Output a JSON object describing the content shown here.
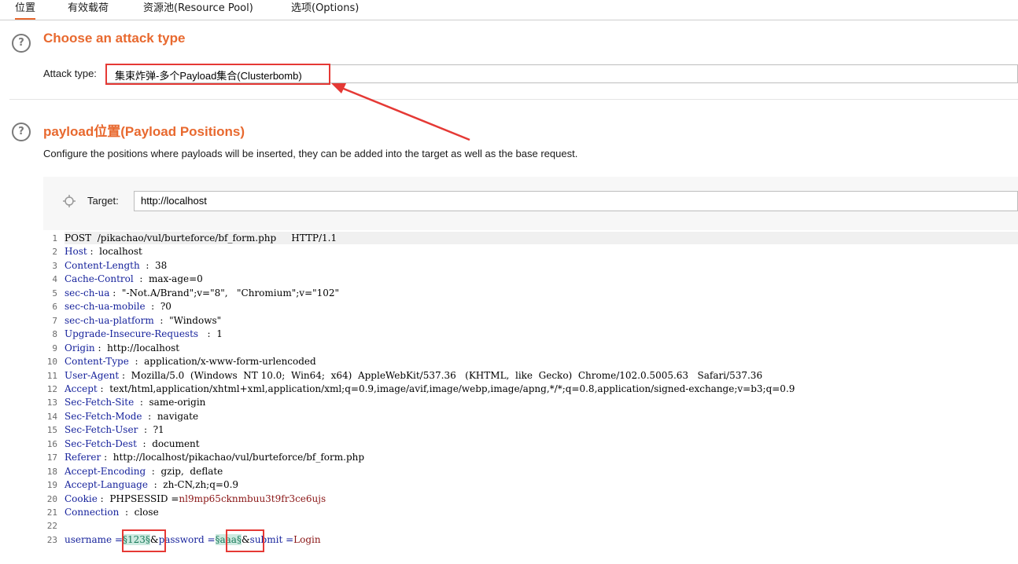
{
  "tabs": [
    {
      "label": "位置",
      "active": true
    },
    {
      "label": "有效载荷",
      "active": false
    },
    {
      "label": "资源池(Resource Pool)",
      "active": false
    },
    {
      "label": "选项(Options)",
      "active": false
    }
  ],
  "attack_section": {
    "help_glyph": "?",
    "title": "Choose an attack type",
    "attack_type_label": "Attack type:",
    "attack_type_value": "集束炸弹-多个Payload集合(Clusterbomb)"
  },
  "positions_section": {
    "help_glyph": "?",
    "title": "payload位置(Payload Positions)",
    "description": "Configure the positions where payloads will be inserted, they can be added into the target as well as the base request.",
    "target_label": "Target:",
    "target_value": "http://localhost"
  },
  "request_lines": [
    {
      "n": "1",
      "text": "POST  /pikachao/vul/burteforce/bf_form.php     HTTP/1.1"
    },
    {
      "n": "2",
      "key": "Host",
      "sep": " :  ",
      "val": "localhost"
    },
    {
      "n": "3",
      "key": "Content-Length",
      "sep": "  :  ",
      "val": "38"
    },
    {
      "n": "4",
      "key": "Cache-Control",
      "sep": "  :  ",
      "val": "max-age=0"
    },
    {
      "n": "5",
      "key": "sec-ch-ua",
      "sep": " :  ",
      "val": "\"-Not.A/Brand\";v=\"8\",   \"Chromium\";v=\"102\""
    },
    {
      "n": "6",
      "key": "sec-ch-ua-mobile",
      "sep": "  :  ",
      "val": "?0"
    },
    {
      "n": "7",
      "key": "sec-ch-ua-platform",
      "sep": "  :  ",
      "val": "\"Windows\""
    },
    {
      "n": "8",
      "key": "Upgrade-Insecure-Requests",
      "sep": "   :  ",
      "val": "1"
    },
    {
      "n": "9",
      "key": "Origin",
      "sep": " :  ",
      "val": "http://localhost"
    },
    {
      "n": "10",
      "key": "Content-Type",
      "sep": "  :  ",
      "val": "application/x-www-form-urlencoded"
    },
    {
      "n": "11",
      "key": "User-Agent",
      "sep": " :  ",
      "val": "Mozilla/5.0  (Windows  NT 10.0;  Win64;  x64)  AppleWebKit/537.36   (KHTML,  like  Gecko)  Chrome/102.0.5005.63   Safari/537.36"
    },
    {
      "n": "12",
      "key": "Accept",
      "sep": " :  ",
      "val": "text/html,application/xhtml+xml,application/xml;q=0.9,image/avif,image/webp,image/apng,*/*;q=0.8,application/signed-exchange;v=b3;q=0.9"
    },
    {
      "n": "13",
      "key": "Sec-Fetch-Site",
      "sep": "  :  ",
      "val": "same-origin"
    },
    {
      "n": "14",
      "key": "Sec-Fetch-Mode",
      "sep": "  :  ",
      "val": "navigate"
    },
    {
      "n": "15",
      "key": "Sec-Fetch-User",
      "sep": "  :  ",
      "val": "?1"
    },
    {
      "n": "16",
      "key": "Sec-Fetch-Dest",
      "sep": "  :  ",
      "val": "document"
    },
    {
      "n": "17",
      "key": "Referer",
      "sep": " :  ",
      "val": "http://localhost/pikachao/vul/burteforce/bf_form.php"
    },
    {
      "n": "18",
      "key": "Accept-Encoding",
      "sep": "  :  ",
      "val": "gzip,  deflate"
    },
    {
      "n": "19",
      "key": "Accept-Language",
      "sep": "  :  ",
      "val": "zh-CN,zh;q=0.9"
    },
    {
      "n": "20",
      "key": "Cookie",
      "sep": " :  ",
      "val": "PHPSESSID =",
      "val2": "nl9mp65cknmbuu3t9fr3ce6ujs"
    },
    {
      "n": "21",
      "key": "Connection",
      "sep": "  :  ",
      "val": "close"
    },
    {
      "n": "22",
      "text": ""
    },
    {
      "n": "23",
      "body": true
    }
  ],
  "body_line": {
    "p1": "username =",
    "m1": "§123§",
    "amp1": "&",
    "p2": "password =",
    "m2": "§aaa§",
    "amp2": "&",
    "p3": "submit =",
    "v3": "Login"
  },
  "highlight_color": "#e53935",
  "accent_color": "#e8692f"
}
